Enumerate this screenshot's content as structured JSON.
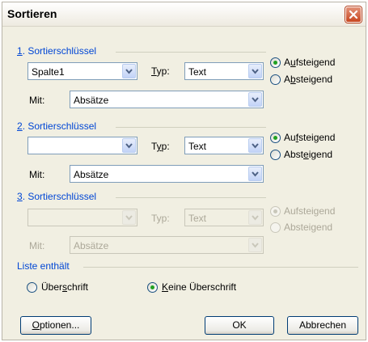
{
  "window": {
    "title": "Sortieren"
  },
  "key1": {
    "group_label_prefix": "1",
    "group_label_rest": ". Sortierschlüssel",
    "column_value": "Spalte1",
    "type_label_u": "T",
    "type_label_rest": "yp:",
    "type_value": "Text",
    "with_label": "Mit:",
    "with_value": "Absätze",
    "ascending_pre": "A",
    "ascending_u": "u",
    "ascending_post": "fsteigend",
    "descending_pre": "A",
    "descending_u": "b",
    "descending_post": "steigend",
    "selected": "ascending"
  },
  "key2": {
    "group_label_prefix": "2",
    "group_label_rest": ". Sortierschlüssel",
    "column_value": "",
    "type_label_pre": "T",
    "type_label_u": "y",
    "type_label_rest": "p:",
    "type_value": "Text",
    "with_label": "Mit:",
    "with_value": "Absätze",
    "ascending_pre": "Au",
    "ascending_u": "f",
    "ascending_post": "steigend",
    "descending_pre": "Abst",
    "descending_u": "e",
    "descending_post": "igend",
    "selected": "ascending"
  },
  "key3": {
    "group_label_prefix": "3",
    "group_label_rest": ". Sortierschlüssel",
    "column_value": "",
    "type_label": "Typ:",
    "type_value": "Text",
    "with_label": "Mit:",
    "with_value": "Absätze",
    "ascending": "Aufsteigend",
    "descending": "Absteigend",
    "disabled": true
  },
  "list": {
    "group_label": "Liste enthält",
    "header_pre": "Über",
    "header_u": "s",
    "header_post": "chrift",
    "noheader_u": "K",
    "noheader_post": "eine Überschrift",
    "selected": "no_header"
  },
  "buttons": {
    "options_u": "O",
    "options_post": "ptionen...",
    "ok": "OK",
    "cancel": "Abbrechen"
  }
}
